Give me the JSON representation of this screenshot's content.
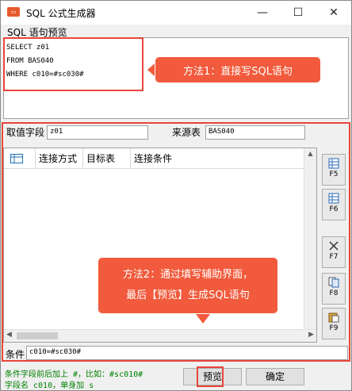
{
  "window": {
    "title": "SQL 公式生成器",
    "minimize": "—",
    "maximize": "☐",
    "close": "✕"
  },
  "menu": {
    "sql_preview": "SQL 语句预览"
  },
  "sql": {
    "line1": "SELECT z01",
    "line2": "FROM BAS040",
    "line3": "WHERE c010=#sc030#"
  },
  "callouts": {
    "method1": "方法1：直接写SQL语句",
    "method2_line1": "方法2：通过填写辅助界面，",
    "method2_line2": "最后【预览】生成SQL语句"
  },
  "fields": {
    "value_field_label": "取值字段",
    "value_field_value": "z01",
    "source_table_label": "来源表",
    "source_table_value": "BAS040"
  },
  "grid": {
    "columns": [
      "连接方式",
      "目标表",
      "连接条件"
    ]
  },
  "side_buttons": [
    "F5",
    "F6",
    "F7",
    "F8",
    "F9"
  ],
  "condition": {
    "label": "条件",
    "value": "c010=#sc030#"
  },
  "hints": {
    "line1": "条件字段前后加上 #，比如：#sc010#",
    "line2": "字段名 c010，单身加 s"
  },
  "buttons": {
    "preview": "预览",
    "confirm": "确定"
  },
  "colors": {
    "highlight": "#e8453c",
    "callout": "#f15a3c",
    "hint_text": "#008000"
  }
}
